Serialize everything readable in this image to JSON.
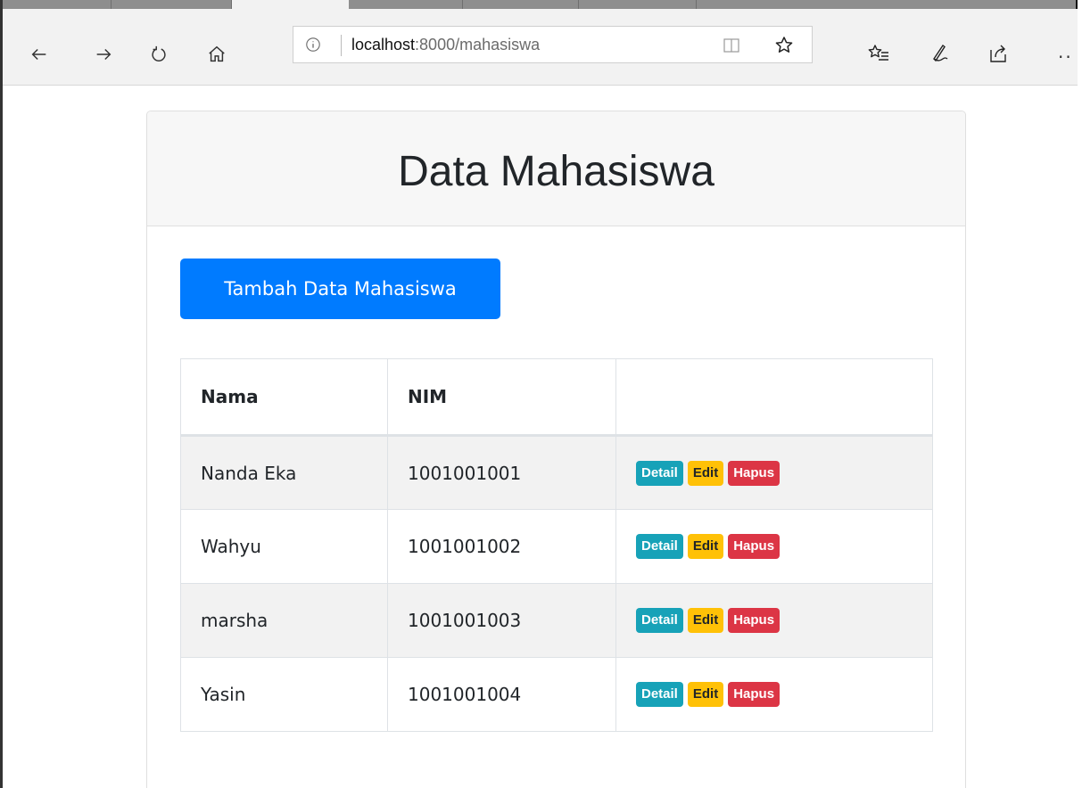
{
  "browser": {
    "url_host": "localhost",
    "url_rest": ":8000/mahasiswa",
    "more_label": "··"
  },
  "page": {
    "title": "Data Mahasiswa",
    "add_button_label": "Tambah Data Mahasiswa"
  },
  "table": {
    "headers": [
      "Nama",
      "NIM",
      ""
    ],
    "rows": [
      {
        "nama": "Nanda Eka",
        "nim": "1001001001"
      },
      {
        "nama": "Wahyu",
        "nim": "1001001002"
      },
      {
        "nama": "marsha",
        "nim": "1001001003"
      },
      {
        "nama": "Yasin",
        "nim": "1001001004"
      }
    ],
    "actions": {
      "detail": "Detail",
      "edit": "Edit",
      "hapus": "Hapus"
    }
  },
  "colors": {
    "primary": "#007bff",
    "info": "#17a2b8",
    "warning": "#ffc107",
    "danger": "#dc3545"
  }
}
